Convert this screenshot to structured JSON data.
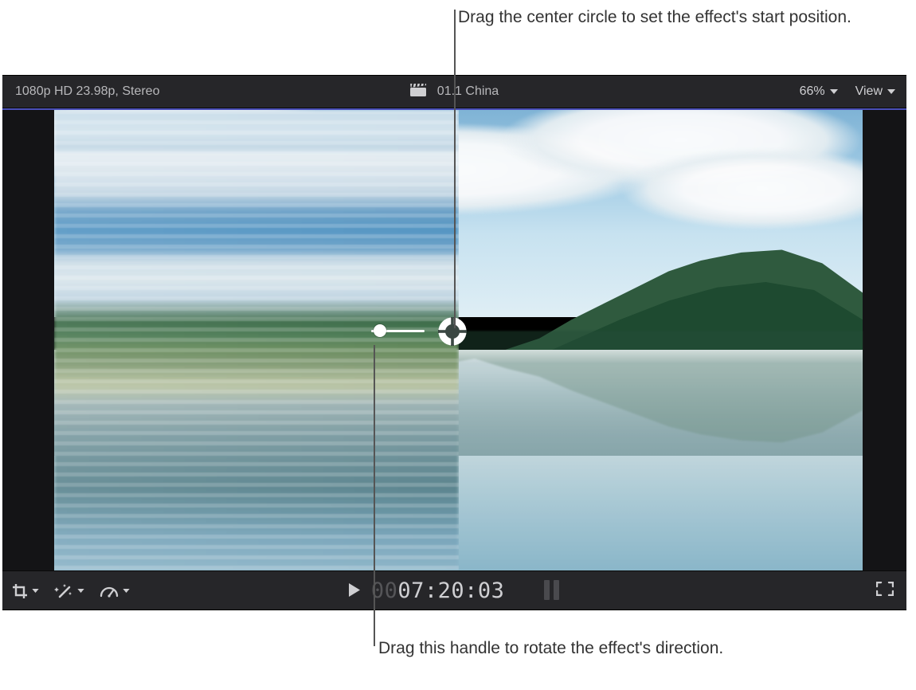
{
  "annotations": {
    "top": "Drag the center circle to set the effect's start position.",
    "bottom": "Drag this handle to rotate the effect's direction."
  },
  "top_bar": {
    "format_info": "1080p HD 23.98p, Stereo",
    "clip_name": "01.1 China",
    "zoom_level": "66%",
    "view_label": "View"
  },
  "bottom_bar": {
    "timecode_leading": "00",
    "timecode_value": "07:20:03"
  },
  "icons": {
    "clapper": "clapperboard-icon",
    "crop": "crop-icon",
    "wand": "enhance-wand-icon",
    "retime": "retime-speed-icon",
    "play": "play-icon",
    "loop": "loop-range-icon",
    "fullscreen": "fullscreen-icon",
    "chevron": "chevron-down-icon"
  },
  "effect_control": {
    "center": "center-ring-handle",
    "rotation": "rotation-direction-handle"
  }
}
